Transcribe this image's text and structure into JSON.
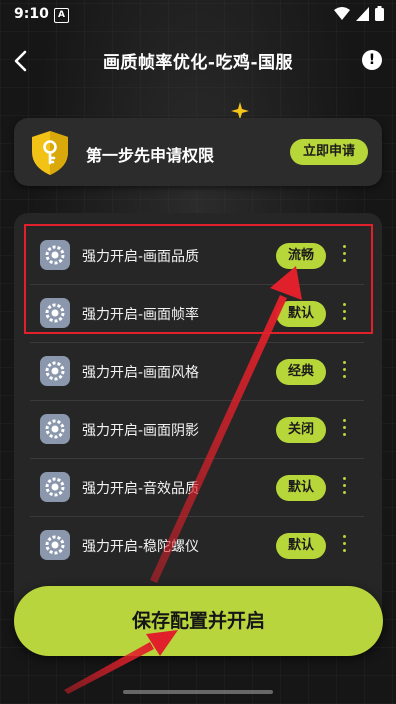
{
  "status_bar": {
    "time": "9:10",
    "notification_badge": "A",
    "icons": [
      "wifi-icon",
      "signal-icon",
      "battery-icon"
    ]
  },
  "header": {
    "title": "画质帧率优化-吃鸡-国服",
    "back_icon": "chevron-left-icon",
    "info_icon": "exclamation-icon",
    "info_symbol": "!"
  },
  "permission": {
    "text": "第一步先申请权限",
    "button_label": "立即申请",
    "icon": "shield-key-icon"
  },
  "settings": [
    {
      "label": "强力开启-画面品质",
      "value": "流畅"
    },
    {
      "label": "强力开启-画面帧率",
      "value": "默认"
    },
    {
      "label": "强力开启-画面风格",
      "value": "经典"
    },
    {
      "label": "强力开启-画面阴影",
      "value": "关闭"
    },
    {
      "label": "强力开启-音效品质",
      "value": "默认"
    },
    {
      "label": "强力开启-稳陀螺仪",
      "value": "默认"
    }
  ],
  "save_button": {
    "label": "保存配置并开启"
  },
  "colors": {
    "accent": "#b7d63a",
    "background": "#161616",
    "card": "#2c2c2c",
    "highlight": "#e0202a"
  }
}
